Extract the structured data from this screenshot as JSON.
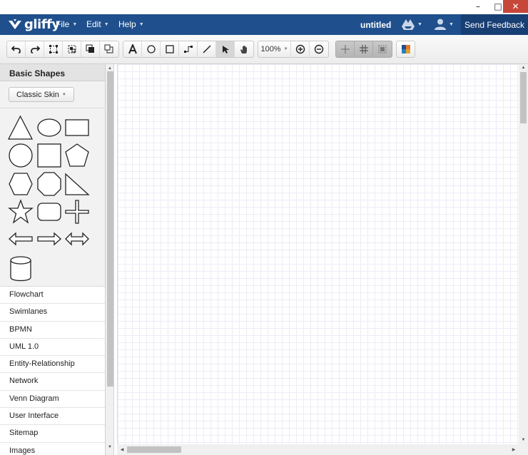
{
  "window": {
    "minimize_glyph": "–",
    "maximize_glyph": "□",
    "close_glyph": "✕"
  },
  "header": {
    "logo_text": "gliffy",
    "menus": [
      {
        "label": "File"
      },
      {
        "label": "Edit"
      },
      {
        "label": "Help"
      }
    ],
    "document_title": "untitled",
    "feedback_label": "Send Feedback",
    "bg_color": "#1f4f8c"
  },
  "toolbar": {
    "zoom": "100%",
    "buttons": [
      "undo-icon",
      "redo-icon",
      "select-all-icon",
      "group-icon",
      "bring-front-icon",
      "send-back-icon",
      "text-tool-icon",
      "ellipse-tool-icon",
      "rectangle-tool-icon",
      "connector-tool-icon",
      "line-tool-icon",
      "pointer-tool-icon",
      "pan-tool-icon",
      "zoom-in-icon",
      "zoom-out-icon",
      "snap-to-grid-icon",
      "show-grid-icon",
      "page-boundary-icon",
      "theme-icon"
    ]
  },
  "sidebar": {
    "library_title": "Basic Shapes",
    "skin_label": "Classic Skin",
    "shapes": [
      "triangle",
      "ellipse",
      "rectangle",
      "circle",
      "square",
      "pentagon",
      "hexagon",
      "octagon",
      "right-triangle",
      "star",
      "rounded-rectangle",
      "cross",
      "left-arrow",
      "right-arrow",
      "double-arrow",
      "cylinder"
    ],
    "libraries": [
      {
        "label": "Flowchart"
      },
      {
        "label": "Swimlanes"
      },
      {
        "label": "BPMN"
      },
      {
        "label": "UML 1.0"
      },
      {
        "label": "Entity-Relationship"
      },
      {
        "label": "Network"
      },
      {
        "label": "Venn Diagram"
      },
      {
        "label": "User Interface"
      },
      {
        "label": "Sitemap"
      },
      {
        "label": "Images"
      }
    ]
  }
}
